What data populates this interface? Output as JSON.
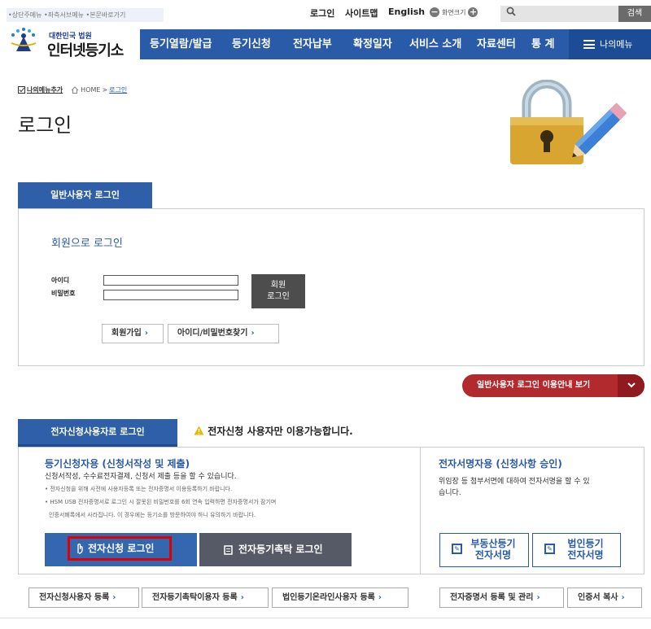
{
  "util": {
    "skip_links": "•상단주메뉴 •좌측서브메뉴 •본문바로가기",
    "login": "로그인",
    "sitemap": "사이트맵",
    "english": "English",
    "fontsize_label": "화면크기",
    "font_minus": "−",
    "font_plus": "+",
    "search_button": "검색",
    "search_placeholder": ""
  },
  "logo": {
    "court": "대한민국 법원",
    "name": "인터넷등기소"
  },
  "nav": {
    "items": [
      "등기열람/발급",
      "등기신청",
      "전자납부",
      "확정일자",
      "서비스 소개",
      "자료센터",
      "통 계"
    ],
    "my_menu": "나의메뉴"
  },
  "breadcrumb": {
    "add_menu": "나의메뉴추가",
    "home": "HOME",
    "sep": ">",
    "current": "로그인"
  },
  "page_title": "로그인",
  "general": {
    "tab": "일반사용자 로그인",
    "member_title": "회원으로 로그인",
    "id_label": "아이디",
    "pw_label": "비밀번호",
    "login_btn_line1": "회원",
    "login_btn_line2": "로그인",
    "signup": "회원가입",
    "find": "아이디/비밀번호찾기",
    "guide": "일반사용자 로그인 이용안내 보기"
  },
  "efiling": {
    "tab": "전자신청사용자로 로그인",
    "warning": "전자신청 사용자만 이용가능합니다.",
    "left_title": "등기신청자용 (신청서작성 및 제출)",
    "left_desc": "신청서작성, 수수료전자결제, 신청서 제출 등을 할 수 있습니다.",
    "note1": "• 전자신청을 위해 사전에 사용자등록 또는 전자증명서 이용등록하기 바랍니다.",
    "note2": "• HSM USB 전자증명서로 로그인 시 잘못된 비밀번호를 6회 연속 입력하면 전자증명서가 잠기며",
    "note3": "인증서폐록에서 사라집니다. 이 경우에는 등기소를 방문하여야 하니 유의하기 바랍니다.",
    "efile_login": "전자신청 로그인",
    "trust_login": "전자등기촉탁 로그인",
    "right_title": "전자서명자용 (신청사항 승인)",
    "right_desc1": "위임장 등 첨부서면에 대하여 전자서명을 할 수 있",
    "right_desc2": "습니다.",
    "sign_realty_1": "부동산등기",
    "sign_realty_2": "전자서명",
    "sign_corp_1": "법인등기",
    "sign_corp_2": "전자서명",
    "bottom": [
      "전자신청사용자 등록",
      "전자등기촉탁이용자 등록",
      "법인등기온라인사용자 등록",
      "전자증명서 등록 및 관리",
      "인증서 복사"
    ]
  },
  "arrow": "›",
  "chevron": "⌄",
  "colors": {
    "nav": "#2a5ba8",
    "accent_red": "#b22a2e",
    "highlight": "#e00000"
  }
}
